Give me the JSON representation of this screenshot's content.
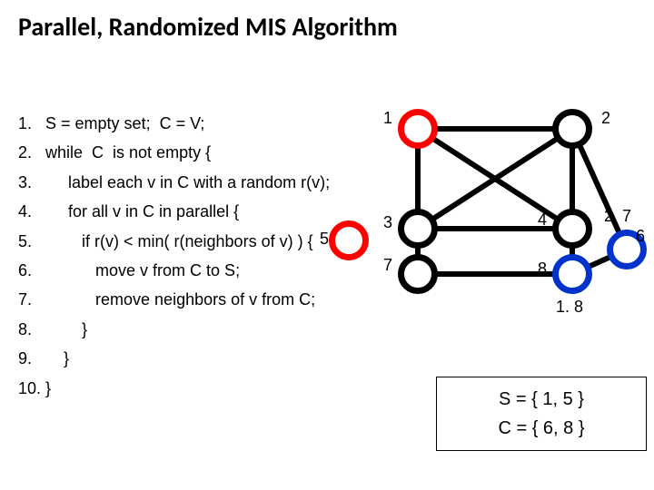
{
  "title": "Parallel, Randomized MIS Algorithm",
  "algo": {
    "l1": "1.   S = empty set;  C = V;",
    "l2": "2.   while  C  is not empty {",
    "l3": "3.        label each v in C with a random r(v);",
    "l4": "4.        for all v in C in parallel {",
    "l5": "5.           if r(v) < min( r(neighbors of v) ) {",
    "l6": "6.              move v from C to S;",
    "l7": "7.              remove neighbors of v from C;",
    "l8": "8.           }",
    "l9": "9.       }",
    "l10": "10. }"
  },
  "graph": {
    "nodes": {
      "n1": {
        "id": "1",
        "color": "red"
      },
      "n2": {
        "id": "2",
        "color": "black"
      },
      "n3": {
        "id": "3",
        "color": "black"
      },
      "n4": {
        "id": "4",
        "color": "black"
      },
      "n5": {
        "id": "5",
        "color": "red"
      },
      "n6": {
        "id": "6",
        "color": "blue"
      },
      "n7": {
        "id": "7",
        "color": "black"
      },
      "n8": {
        "id": "8",
        "color": "blue"
      }
    },
    "labels": {
      "n2_7": "2. 7",
      "n6": "6",
      "n1_8": "1. 8"
    }
  },
  "sets": {
    "s": "S = { 1, 5 }",
    "c": "C = { 6, 8 }"
  },
  "inline5": "5"
}
